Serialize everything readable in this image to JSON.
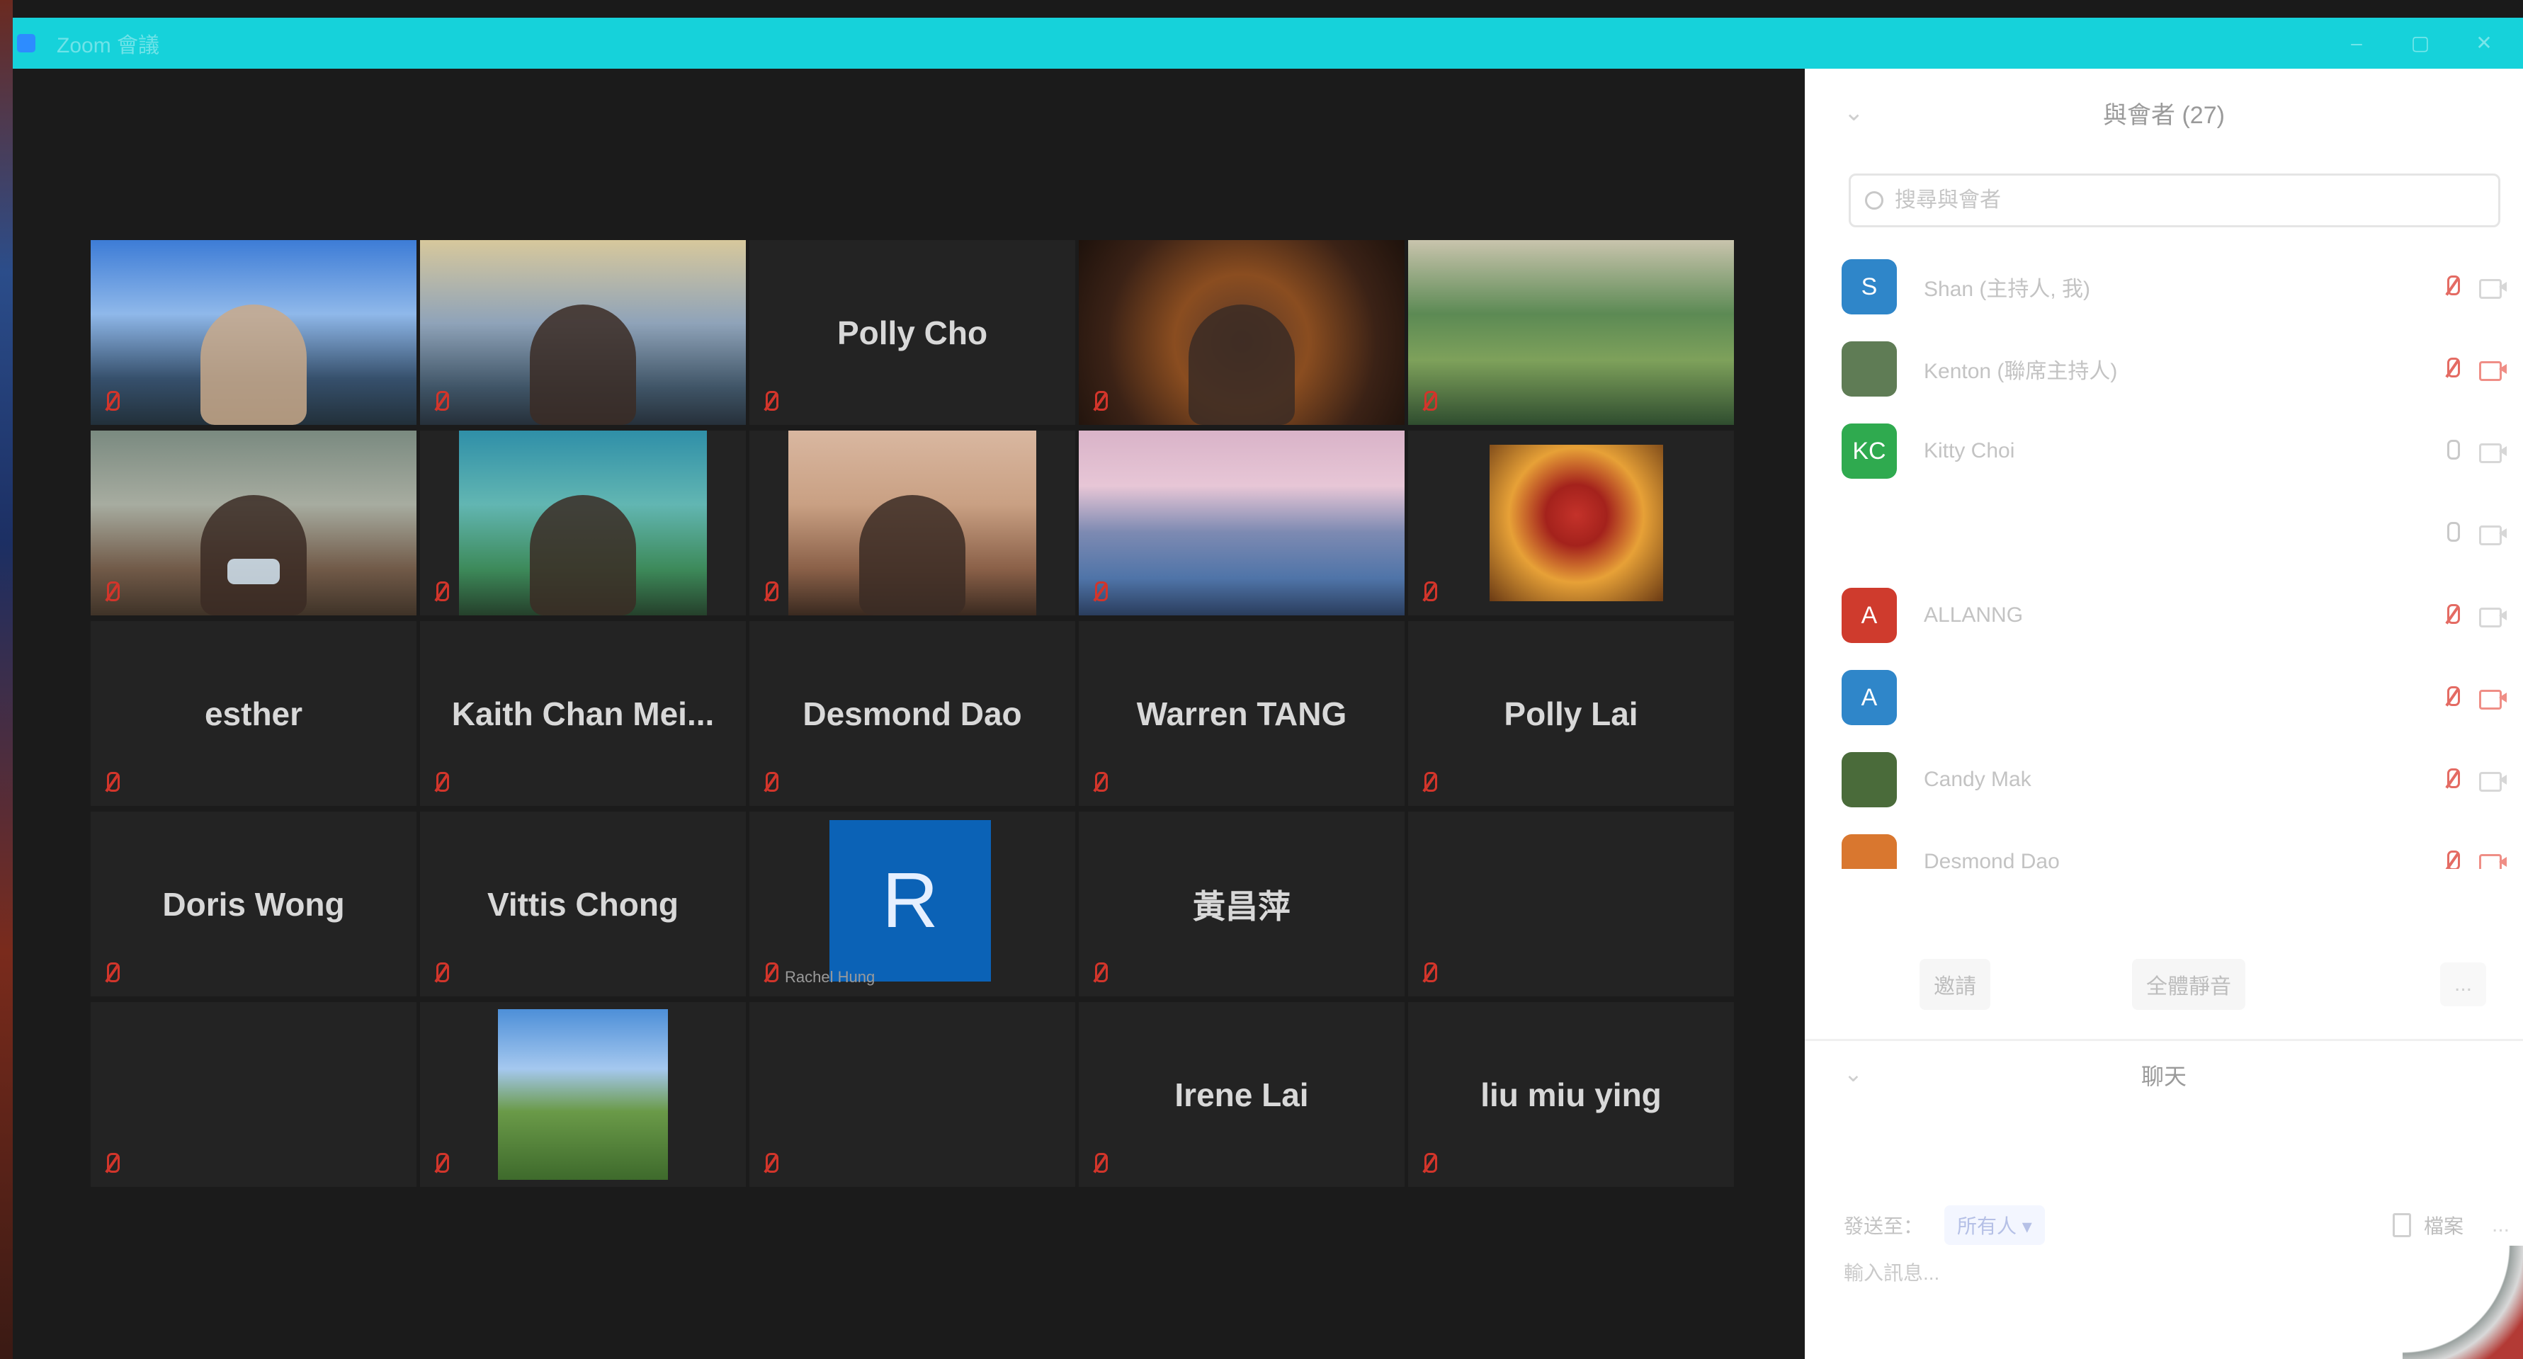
{
  "window": {
    "title": "Zoom 會議"
  },
  "meeting": {
    "tiles": [
      {
        "name": "",
        "scene": "sky",
        "caption": ""
      },
      {
        "name": "",
        "scene": "sunset",
        "caption": ""
      },
      {
        "name": "Polly Cho",
        "scene": "none",
        "caption": ""
      },
      {
        "name": "",
        "scene": "dinner",
        "caption": "",
        "active": true
      },
      {
        "name": "",
        "scene": "river",
        "caption": ""
      },
      {
        "name": "",
        "scene": "office",
        "caption": ""
      },
      {
        "name": "",
        "scene": "lake",
        "caption": ""
      },
      {
        "name": "",
        "scene": "room",
        "caption": ""
      },
      {
        "name": "",
        "scene": "fuji",
        "caption": ""
      },
      {
        "name": "",
        "scene": "heart",
        "caption": ""
      },
      {
        "name": "esther",
        "scene": "none",
        "caption": ""
      },
      {
        "name": "Kaith Chan Mei...",
        "scene": "none",
        "caption": ""
      },
      {
        "name": "Desmond Dao",
        "scene": "none",
        "caption": ""
      },
      {
        "name": "Warren TANG",
        "scene": "none",
        "caption": ""
      },
      {
        "name": "Polly Lai",
        "scene": "none",
        "caption": ""
      },
      {
        "name": "Doris Wong",
        "scene": "none",
        "caption": ""
      },
      {
        "name": "Vittis Chong",
        "scene": "none",
        "caption": ""
      },
      {
        "name": "",
        "scene": "avatar",
        "avatar_letter": "R",
        "caption": "Rachel Hung"
      },
      {
        "name": "黃昌萍",
        "scene": "none",
        "caption": ""
      },
      {
        "name": "",
        "scene": "none",
        "caption": ""
      },
      {
        "name": "",
        "scene": "none",
        "caption": ""
      },
      {
        "name": "",
        "scene": "hill",
        "caption": ""
      },
      {
        "name": "",
        "scene": "none",
        "caption": ""
      },
      {
        "name": "Irene Lai",
        "scene": "none",
        "caption": ""
      },
      {
        "name": "liu miu ying",
        "scene": "none",
        "caption": ""
      }
    ]
  },
  "participants_panel": {
    "title": "與會者 (27)",
    "search_placeholder": "搜尋與會者",
    "list": [
      {
        "initial": "S",
        "color": "#2f86c9",
        "name": "Shan (主持人, 我)",
        "muted": true,
        "video_off": false
      },
      {
        "initial": "",
        "color": "#5f7c55",
        "name": "Kenton (聯席主持人)",
        "muted": true,
        "video_off": true
      },
      {
        "initial": "KC",
        "color": "#2faa4f",
        "name": "Kitty Choi",
        "muted": false,
        "video_off": false
      },
      {
        "initial": "",
        "color": "#ffffff",
        "name": "",
        "muted": false,
        "video_off": false
      },
      {
        "initial": "A",
        "color": "#cf3b2d",
        "name": "ALLANNG",
        "muted": true,
        "video_off": false
      },
      {
        "initial": "A",
        "color": "#2f86c9",
        "name": "",
        "muted": true,
        "video_off": true
      },
      {
        "initial": "",
        "color": "#4a6b3a",
        "name": "Candy Mak",
        "muted": true,
        "video_off": false
      },
      {
        "initial": "",
        "color": "#d9772f",
        "name": "Desmond Dao",
        "muted": true,
        "video_off": true
      }
    ],
    "invite_label": "邀請",
    "mute_all_label": "全體靜音",
    "more_label": "..."
  },
  "chat_panel": {
    "title": "聊天",
    "to_label": "發送至：",
    "to_value": "所有人 ▾",
    "file_label": "檔案",
    "more_label": "...",
    "input_placeholder": "輸入訊息..."
  }
}
